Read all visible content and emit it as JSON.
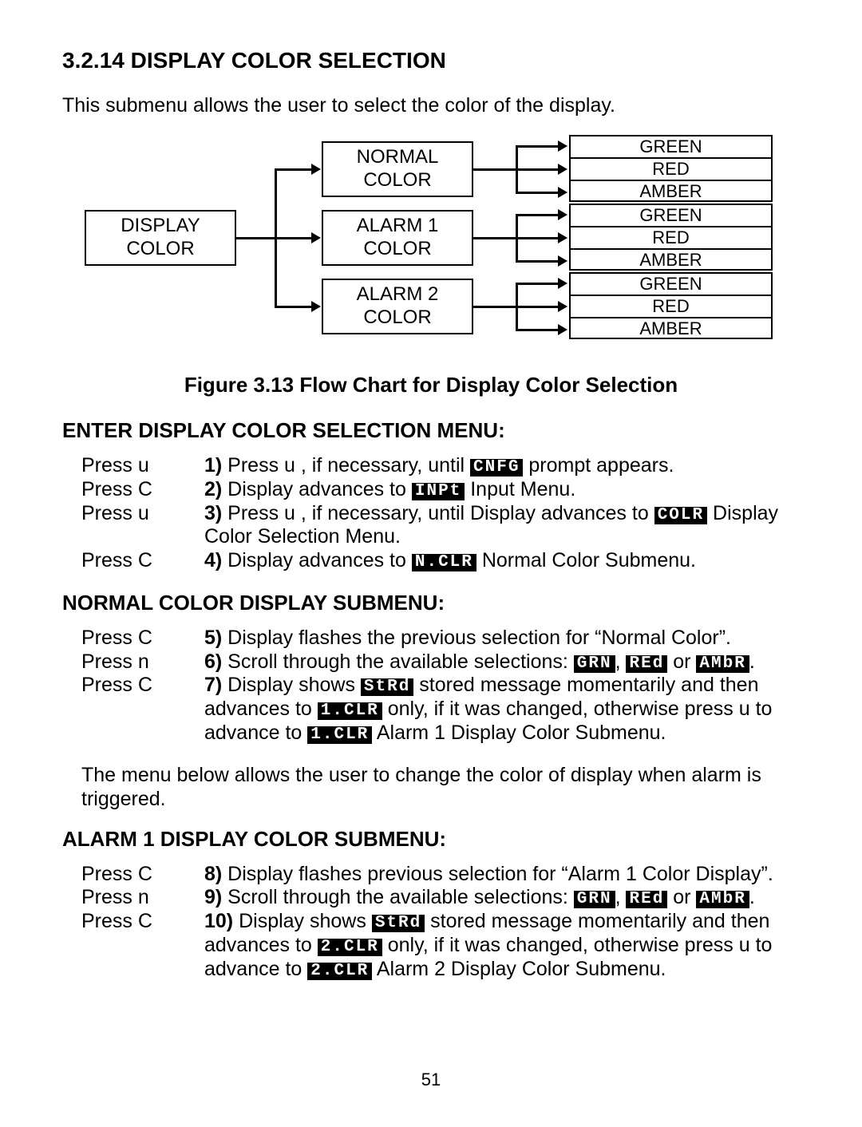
{
  "section_number": "3.2.14",
  "section_title": "DISPLAY COLOR SELECTION",
  "intro": "This submenu allows the user to select  the color of the display.",
  "chart_data": {
    "type": "tree",
    "root": "DISPLAY COLOR",
    "branches": [
      {
        "label": "NORMAL COLOR",
        "options": [
          "GREEN",
          "RED",
          "AMBER"
        ]
      },
      {
        "label": "ALARM 1 COLOR",
        "options": [
          "GREEN",
          "RED",
          "AMBER"
        ]
      },
      {
        "label": "ALARM 2 COLOR",
        "options": [
          "GREEN",
          "RED",
          "AMBER"
        ]
      }
    ]
  },
  "figure_caption": "Figure 3.13 Flow Chart for Display Color Selection",
  "menu1": {
    "heading": "ENTER DISPLAY COLOR SELECTION MENU:",
    "rows": [
      {
        "key": "Press  u",
        "num": "1)",
        "pre": " Press u , if necessary, until ",
        "seg": "CNFG",
        "post": " prompt appears."
      },
      {
        "key": "Press  C",
        "num": "2)",
        "pre": " Display advances to ",
        "seg": "INPt",
        "post": " Input Menu."
      },
      {
        "key": "Press  u",
        "num": "3)",
        "pre": " Press u , if necessary, until Display advances to ",
        "seg": "COLR",
        "post": " Display Color Selection Menu."
      },
      {
        "key": "Press  C",
        "num": "4)",
        "pre": " Display advances to ",
        "seg": "N.CLR",
        "post": " Normal Color Submenu."
      }
    ]
  },
  "menu2": {
    "heading": "NORMAL COLOR DISPLAY SUBMENU:",
    "rows": [
      {
        "key": "Press  C",
        "num": "5)",
        "pre": " Display flashes the previous selection for “Normal Color”."
      },
      {
        "key": "Press  n",
        "num": "6)",
        "pre": " Scroll through the available selections: ",
        "seg": "GRN",
        "mid1": ", ",
        "seg2": "REd",
        "mid2": " or ",
        "seg3": "AMbR",
        "post": "."
      },
      {
        "key": "Press  C",
        "num": "7)",
        "pre": " Display shows ",
        "seg": "StRd",
        "mid1": " stored message momentarily and then advances to ",
        "seg2": "1.CLR",
        "mid2": " only, if it was changed, otherwise press u  to advance to ",
        "seg3": "1.CLR",
        "post": " Alarm 1 Display Color Submenu."
      }
    ]
  },
  "note": "The menu below allows the user to change the color of display when alarm is triggered.",
  "menu3": {
    "heading": "ALARM 1 DISPLAY COLOR SUBMENU:",
    "rows": [
      {
        "key": "Press  C",
        "num": "8)",
        "pre": " Display flashes previous selection for “Alarm 1 Color Display”."
      },
      {
        "key": "Press  n",
        "num": "9)",
        "pre": " Scroll through the available selections: ",
        "seg": "GRN",
        "mid1": ", ",
        "seg2": "REd",
        "mid2": " or ",
        "seg3": "AMbR",
        "post": "."
      },
      {
        "key": "Press  C",
        "num": "10)",
        "pre": " Display shows ",
        "seg": "StRd",
        "mid1": " stored message momentarily and then advances to ",
        "seg2": "2.CLR",
        "mid2": " only, if it was changed, otherwise press u  to advance to ",
        "seg3": "2.CLR",
        "post": " Alarm 2 Display Color Submenu."
      }
    ]
  },
  "page_number": "51"
}
